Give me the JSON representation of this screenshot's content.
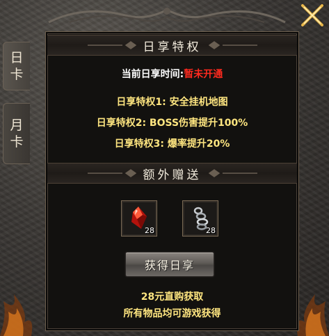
{
  "tabs": [
    {
      "label_top": "日",
      "label_bottom": "卡"
    },
    {
      "label_top": "月",
      "label_bottom": "卡"
    }
  ],
  "privilege": {
    "header": "日享特权",
    "current_label": "当前日享时间:",
    "current_value": "暂未开通",
    "perks": [
      "日享特权1: 安全挂机地图",
      "日享特权2: BOSS伤害提升100%",
      "日享特权3: 爆率提升20%"
    ]
  },
  "extra": {
    "header": "额外赠送",
    "items": [
      {
        "icon": "red-gem-icon",
        "count": "28"
      },
      {
        "icon": "silver-chain-icon",
        "count": "28"
      }
    ]
  },
  "action": {
    "button_label": "获得日享"
  },
  "footer": {
    "line1": "28元直购获取",
    "line2": "所有物品均可游戏获得"
  },
  "colors": {
    "highlight_yellow": "#ffe680",
    "status_red": "#ff2a1f",
    "panel_bg": "#12110f",
    "frame_bg": "#3b3835"
  }
}
